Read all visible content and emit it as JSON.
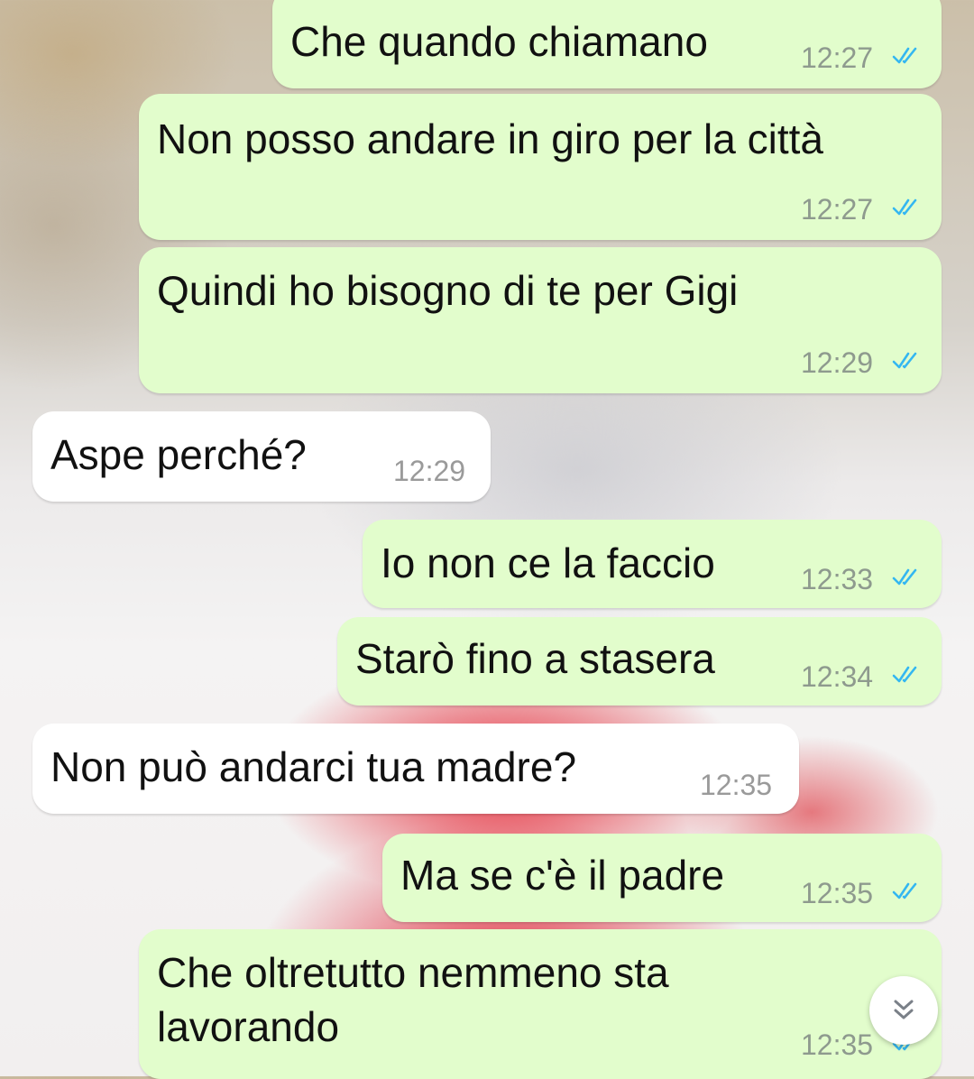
{
  "messages": [
    {
      "direction": "outgoing",
      "text": "Che quando chiamano",
      "time": "12:27",
      "status": "read"
    },
    {
      "direction": "outgoing",
      "text": "Non posso andare in giro per la città",
      "time": "12:27",
      "status": "read"
    },
    {
      "direction": "outgoing",
      "text": "Quindi ho bisogno di te per Gigi",
      "time": "12:29",
      "status": "read"
    },
    {
      "direction": "incoming",
      "text": "Aspe perché?",
      "time": "12:29"
    },
    {
      "direction": "outgoing",
      "text": "Io non ce la faccio",
      "time": "12:33",
      "status": "read"
    },
    {
      "direction": "outgoing",
      "text": "Starò fino a stasera",
      "time": "12:34",
      "status": "read"
    },
    {
      "direction": "incoming",
      "text": "Non può andarci tua madre?",
      "time": "12:35"
    },
    {
      "direction": "outgoing",
      "text": "Ma se c'è il padre",
      "time": "12:35",
      "status": "read"
    },
    {
      "direction": "outgoing",
      "text_line1": "Che oltretutto nemmeno sta",
      "text_line2": "lavorando",
      "time": "12:35",
      "status": "read"
    }
  ],
  "icons": {
    "read_receipt": "double-check-icon",
    "scroll_down": "double-chevron-down-icon"
  },
  "colors": {
    "outgoing_bubble": "#e2fdcc",
    "incoming_bubble": "#ffffff",
    "read_tick": "#34b7f1"
  }
}
